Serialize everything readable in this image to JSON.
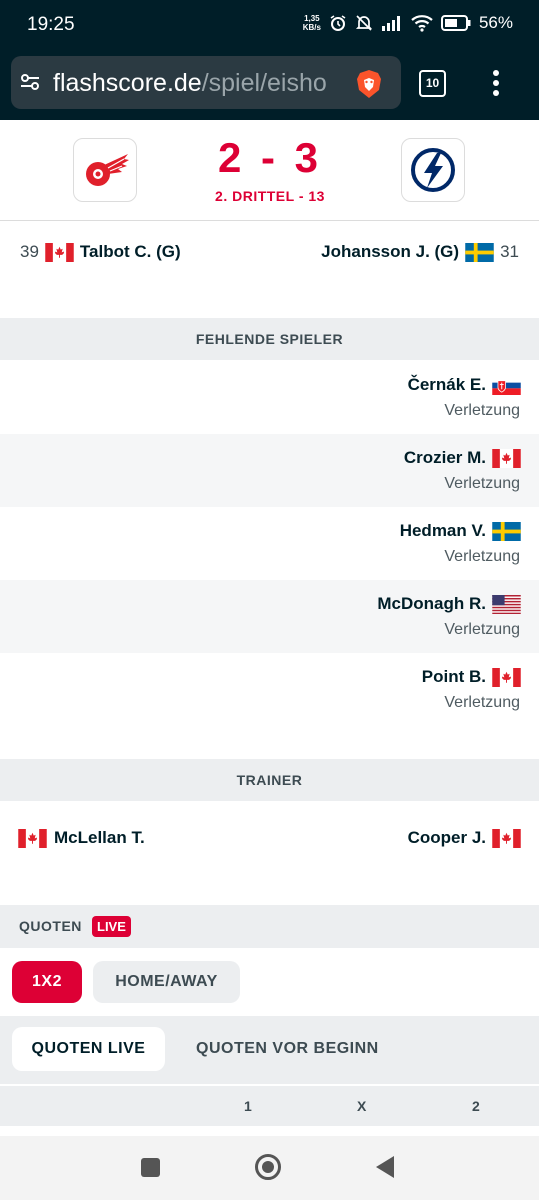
{
  "status_bar": {
    "time": "19:25",
    "speed_top": "1,35",
    "speed_bottom": "KB/s",
    "battery": "56%"
  },
  "browser": {
    "url_host": "flashscore.de",
    "url_path": "/spiel/eisho",
    "tab_count": "10"
  },
  "match": {
    "home_team_icon": "red-wings-logo",
    "away_team_icon": "lightning-logo",
    "score": "2 - 3",
    "period": "2. DRITTEL - 13"
  },
  "goalies": {
    "home": {
      "number": "39",
      "name": "Talbot C. (G)",
      "flag": "canada"
    },
    "away": {
      "number": "31",
      "name": "Johansson J. (G)",
      "flag": "sweden"
    }
  },
  "missing_section": {
    "title": "FEHLENDE SPIELER"
  },
  "missing_players": [
    {
      "name": "Černák E.",
      "reason": "Verletzung",
      "flag": "slovakia"
    },
    {
      "name": "Crozier M.",
      "reason": "Verletzung",
      "flag": "canada"
    },
    {
      "name": "Hedman V.",
      "reason": "Verletzung",
      "flag": "sweden"
    },
    {
      "name": "McDonagh R.",
      "reason": "Verletzung",
      "flag": "usa"
    },
    {
      "name": "Point B.",
      "reason": "Verletzung",
      "flag": "canada"
    }
  ],
  "trainer_section": {
    "title": "TRAINER"
  },
  "trainers": {
    "home": {
      "name": "McLellan T.",
      "flag": "canada"
    },
    "away": {
      "name": "Cooper J.",
      "flag": "canada"
    }
  },
  "odds": {
    "title": "QUOTEN",
    "live_badge": "LIVE",
    "tabs": [
      "1X2",
      "HOME/AWAY"
    ],
    "subtabs": [
      "QUOTEN LIVE",
      "QUOTEN VOR BEGINN"
    ],
    "columns": [
      "1",
      "X",
      "2"
    ]
  },
  "colors": {
    "brand_dark": "#001e28",
    "accent_red": "#dd0035"
  }
}
